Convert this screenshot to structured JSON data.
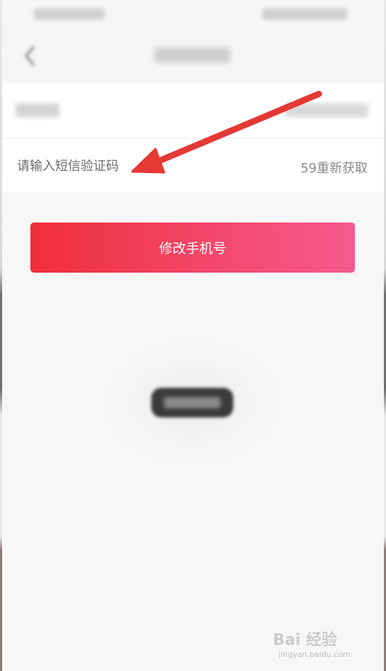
{
  "status_bar": {
    "left_info": "",
    "right_info": ""
  },
  "nav": {
    "back_icon": "chevron-left-icon",
    "title": ""
  },
  "phone_row": {
    "label": "",
    "value": ""
  },
  "code_row": {
    "placeholder": "请输入短信验证码",
    "value": "",
    "resend_label": "59重新获取"
  },
  "submit_button": {
    "label": "修改手机号",
    "gradient_start": "#ef2f3b",
    "gradient_end": "#f55a8f"
  },
  "toast": {
    "text": ""
  },
  "annotation": {
    "arrow_icon": "red-arrow-icon",
    "arrow_color": "#e53935"
  },
  "watermark": {
    "logo_text": "Bai 经验",
    "url": "jingyan.baidu.com"
  }
}
